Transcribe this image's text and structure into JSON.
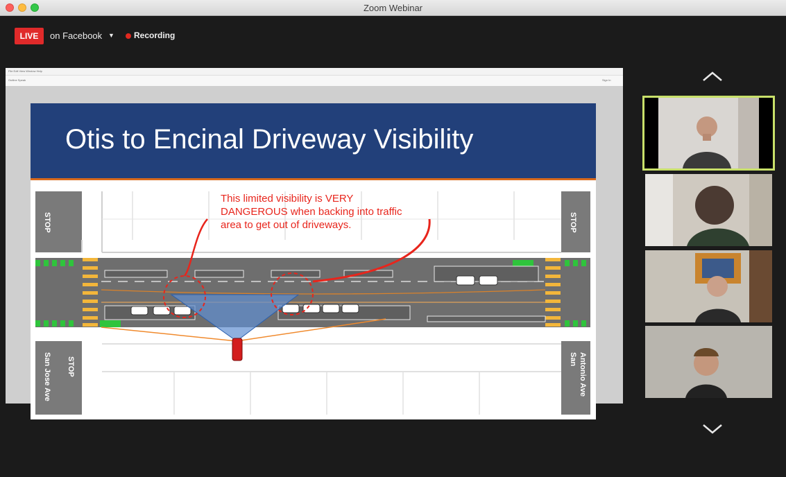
{
  "window": {
    "title": "Zoom Webinar"
  },
  "toolbar": {
    "live_label": "LIVE",
    "stream_target": "on Facebook",
    "recording_label": "Recording"
  },
  "slide": {
    "title": "Otis to Encinal Driveway Visibility",
    "annotation_lines": [
      "This limited visibility is VERY",
      "DANGEROUS when backing into traffic",
      "area to get out of driveways."
    ],
    "left_street": "San Jose Ave",
    "right_street_line1": "San",
    "right_street_line2": "Antonio Ave",
    "stop_label": "STOP",
    "stop_label_rot": "STOP"
  },
  "share_toolbar": {
    "menu": "File  Edit  View  Window  Help",
    "tool_left": "Outline  Speak",
    "sign_in": "Sign In"
  },
  "colors": {
    "accent_live": "#e02a2a",
    "speaker_highlight": "#c8e06a",
    "slide_banner": "#22407a",
    "annotation": "#e8251c"
  },
  "icons": {
    "scroll_up": "chevron-up-icon",
    "scroll_down": "chevron-down-icon"
  }
}
